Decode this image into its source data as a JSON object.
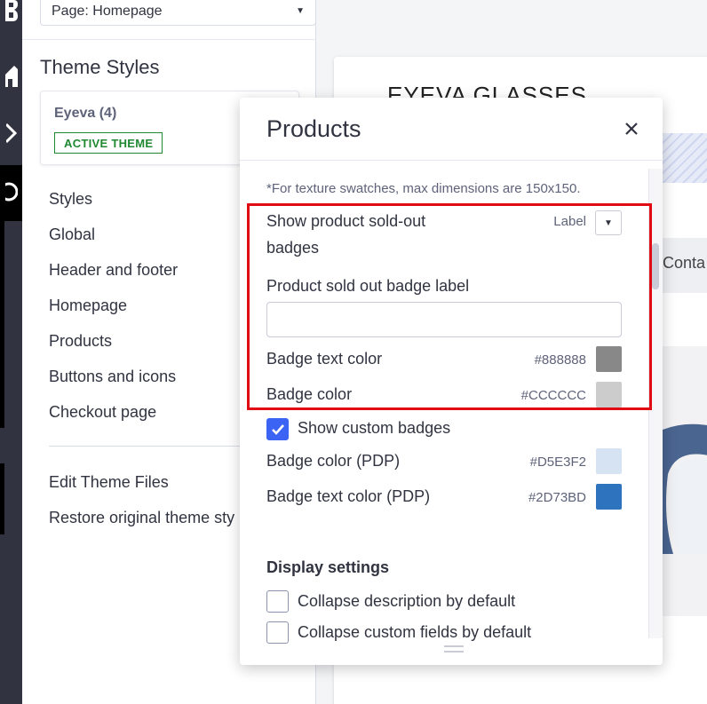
{
  "page_selector": {
    "value": "Page: Homepage"
  },
  "left_panel": {
    "title": "Theme Styles",
    "theme": {
      "name": "Eyeva (4)",
      "badge": "ACTIVE THEME"
    },
    "nav_items": [
      {
        "label": "Styles"
      },
      {
        "label": "Global"
      },
      {
        "label": "Header and footer"
      },
      {
        "label": "Homepage"
      },
      {
        "label": "Products"
      },
      {
        "label": "Buttons and icons"
      },
      {
        "label": "Checkout page"
      }
    ],
    "footer_items": [
      {
        "label": "Edit Theme Files"
      },
      {
        "label": "Restore original theme sty"
      }
    ]
  },
  "preview": {
    "store_name": "EYEVA GLASSES",
    "nav_text": "Conta"
  },
  "modal": {
    "title": "Products",
    "note": "*For texture swatches, max dimensions are 150x150.",
    "sold_out": {
      "label_line1": "Show product sold-out",
      "label_line2": "badges",
      "select_value": "Label",
      "badge_label_title": "Product sold out badge label",
      "badge_label_value": "",
      "badge_text_color_label": "Badge text color",
      "badge_text_color": "#888888",
      "badge_color_label": "Badge color",
      "badge_color": "#CCCCCC"
    },
    "custom_badges": {
      "label": "Show custom badges",
      "checked": true,
      "pdp_color_label": "Badge color (PDP)",
      "pdp_color": "#D5E3F2",
      "pdp_text_color_label": "Badge text color (PDP)",
      "pdp_text_color": "#2D73BD"
    },
    "display_settings": {
      "heading": "Display settings",
      "options": [
        {
          "label": "Collapse description by default",
          "checked": false
        },
        {
          "label": "Collapse custom fields by default",
          "checked": false
        }
      ]
    }
  },
  "colors": {
    "highlight": "#E10B14",
    "accent": "#3C64F4",
    "active_badge": "#208831",
    "rail": "#313440"
  }
}
